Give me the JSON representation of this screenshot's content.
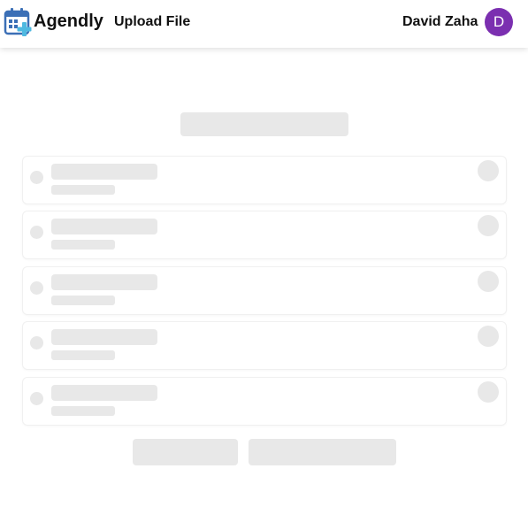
{
  "header": {
    "brand": "Agendly",
    "nav_upload": "Upload File",
    "user_name": "David Zaha",
    "avatar_initial": "D",
    "logo_icon": "calendar-plus-icon"
  },
  "colors": {
    "avatar_bg": "#7b2fb0",
    "logo_blue": "#3b6fb6",
    "logo_cyan": "#4fb9e0",
    "skeleton": "#e8e8e8"
  },
  "loading_state": {
    "list_placeholder_count": 5
  }
}
